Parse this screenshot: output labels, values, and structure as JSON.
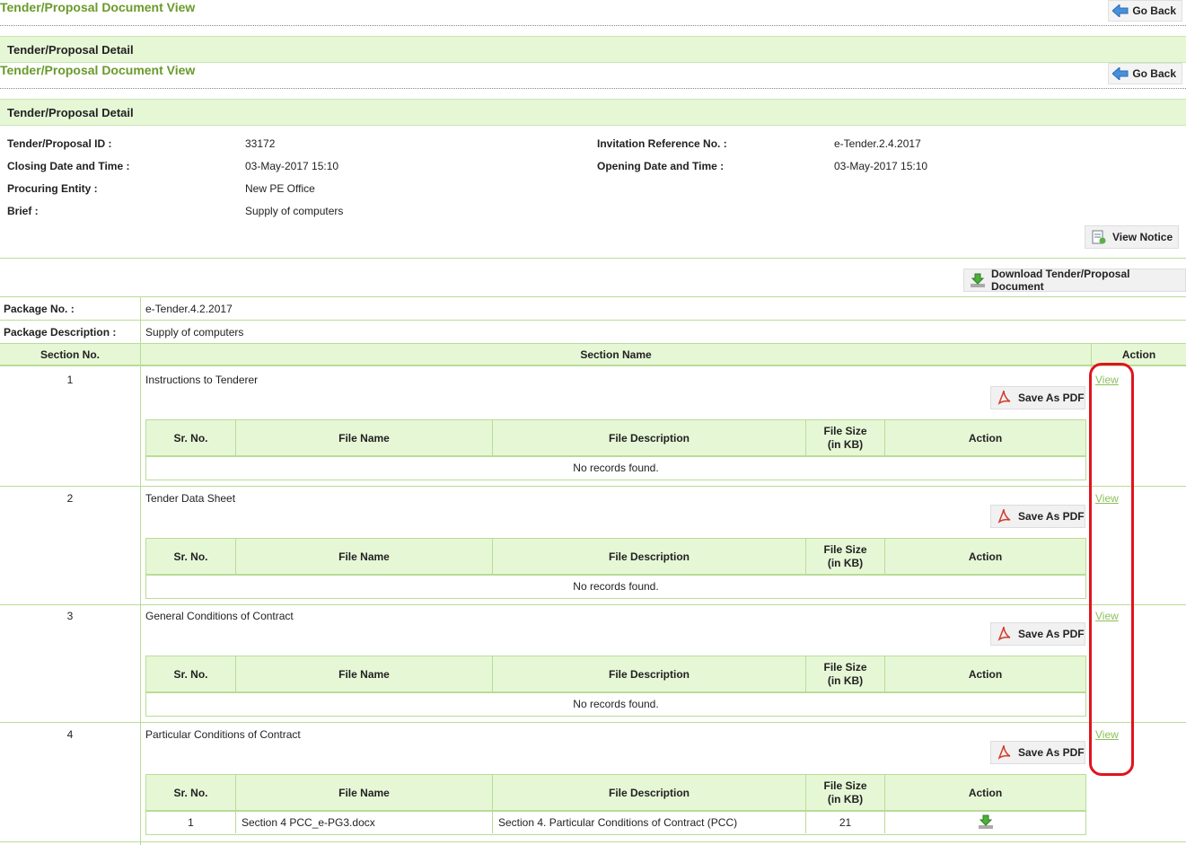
{
  "page_title": "Tender/Proposal Document View",
  "go_back_label": "Go Back",
  "section_title": "Tender/Proposal Detail",
  "details": {
    "tender_id_label": "Tender/Proposal ID :",
    "tender_id": "33172",
    "invitation_ref_label": "Invitation Reference No. :",
    "invitation_ref": "e-Tender.2.4.2017",
    "closing_label": "Closing Date and Time :",
    "closing": "03-May-2017 15:10",
    "opening_label": "Opening Date and Time :",
    "opening": "03-May-2017 15:10",
    "entity_label": "Procuring Entity :",
    "entity": "New PE Office",
    "brief_label": "Brief :",
    "brief": "Supply of computers"
  },
  "view_notice_label": "View Notice",
  "download_label": "Download Tender/Proposal Document",
  "package": {
    "no_label": "Package No. :",
    "no": "e-Tender.4.2.2017",
    "desc_label": "Package Description :",
    "desc": "Supply of computers"
  },
  "columns": {
    "section_no": "Section No.",
    "section_name": "Section Name",
    "action": "Action"
  },
  "inner_columns": {
    "sr_no": "Sr. No.",
    "file_name": "File Name",
    "file_description": "File Description",
    "file_size": "File Size (in KB)",
    "action": "Action"
  },
  "save_pdf_label": "Save As PDF",
  "view_label": "View",
  "no_records": "No records found.",
  "sections": [
    {
      "no": "1",
      "name": "Instructions to Tenderer"
    },
    {
      "no": "2",
      "name": "Tender Data Sheet"
    },
    {
      "no": "3",
      "name": "General Conditions of Contract"
    },
    {
      "no": "4",
      "name": "Particular Conditions of Contract"
    }
  ],
  "section4_file": {
    "sr": "1",
    "name": "Section 4 PCC_e-PG3.docx",
    "description": "Section 4. Particular Conditions of Contract (PCC)",
    "size": "21"
  },
  "colors": {
    "accent_green": "#6a9a2a",
    "header_bg": "#e6f7d6",
    "border_green": "#b9dc96",
    "link_green": "#8cbf5a",
    "highlight_red": "#e0141e"
  }
}
